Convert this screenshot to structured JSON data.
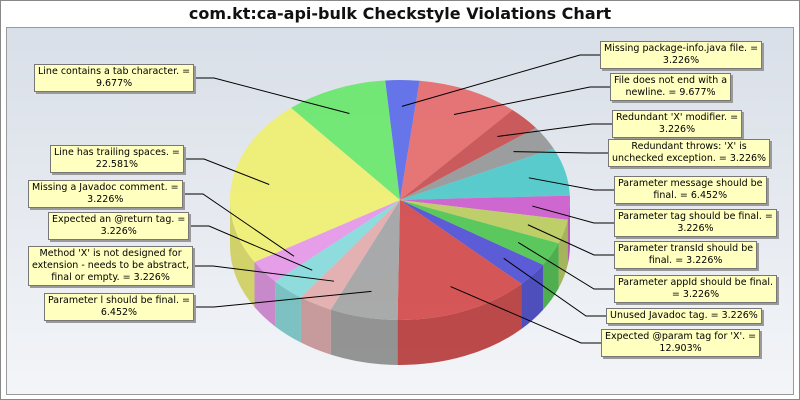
{
  "chart_data": {
    "type": "pie",
    "title": "com.kt:ca-api-bulk Checkstyle Violations Chart",
    "slices": [
      {
        "label": "Missing package-info.java file.",
        "value": 3.226,
        "color": "#4a5be8"
      },
      {
        "label": "File does not end with a newline.",
        "value": 9.677,
        "color": "#e65b5b"
      },
      {
        "label": "Redundant 'X' modifier.",
        "value": 3.226,
        "color": "#c43c3c"
      },
      {
        "label": "Redundant throws: 'X' is unchecked exception.",
        "value": 3.226,
        "color": "#8c8c8c"
      },
      {
        "label": "Parameter message should be final.",
        "value": 6.452,
        "color": "#3cc4c4"
      },
      {
        "label": "Parameter tag should be final.",
        "value": 3.226,
        "color": "#c84cc8"
      },
      {
        "label": "Parameter transId should be final.",
        "value": 3.226,
        "color": "#b4c84c"
      },
      {
        "label": "Parameter appId should be final.",
        "value": 3.226,
        "color": "#3cbf3c"
      },
      {
        "label": "Unused Javadoc tag.",
        "value": 3.226,
        "color": "#3c3cd0"
      },
      {
        "label": "Expected @param tag for 'X'.",
        "value": 12.903,
        "color": "#d03434"
      },
      {
        "label": "Parameter l should be final.",
        "value": 6.452,
        "color": "#9a9a9a"
      },
      {
        "label": "Method 'X' is not designed for extension - needs to be abstract, final or empty.",
        "value": 3.226,
        "color": "#e2a4a4"
      },
      {
        "label": "Expected an @return tag.",
        "value": 3.226,
        "color": "#7ad8d8"
      },
      {
        "label": "Missing a Javadoc comment.",
        "value": 3.226,
        "color": "#e48ce4"
      },
      {
        "label": "Line has trailing spaces.",
        "value": 22.581,
        "color": "#f0f060"
      },
      {
        "label": "Line contains a tab character.",
        "value": 9.677,
        "color": "#5ce85c"
      }
    ],
    "labels": [
      [
        "Missing package-info.java file. =",
        "3.226%"
      ],
      [
        "File does not end with a",
        "newline. = 9.677%"
      ],
      [
        "Redundant 'X' modifier. =",
        "3.226%"
      ],
      [
        "Redundant throws: 'X' is",
        "unchecked exception. = 3.226%"
      ],
      [
        "Parameter message should be",
        "final. = 6.452%"
      ],
      [
        "Parameter tag should be final. =",
        "3.226%"
      ],
      [
        "Parameter transId should be",
        "final. = 3.226%"
      ],
      [
        "Parameter appId should be final.",
        "= 3.226%"
      ],
      [
        "Unused Javadoc tag. = 3.226%"
      ],
      [
        "Expected @param tag for 'X'. =",
        "12.903%"
      ],
      [
        "Parameter l should be final. =",
        "6.452%"
      ],
      [
        "Method 'X' is not designed for",
        "extension - needs to be abstract,",
        "final or empty. = 3.226%"
      ],
      [
        "Expected an @return tag. =",
        "3.226%"
      ],
      [
        "Missing a Javadoc comment. =",
        "3.226%"
      ],
      [
        "Line has trailing spaces. =",
        "22.581%"
      ],
      [
        "Line contains a tab character. =",
        "9.677%"
      ]
    ],
    "start_angle_deg": -95,
    "legend": "none",
    "style": "3d-transparent"
  }
}
